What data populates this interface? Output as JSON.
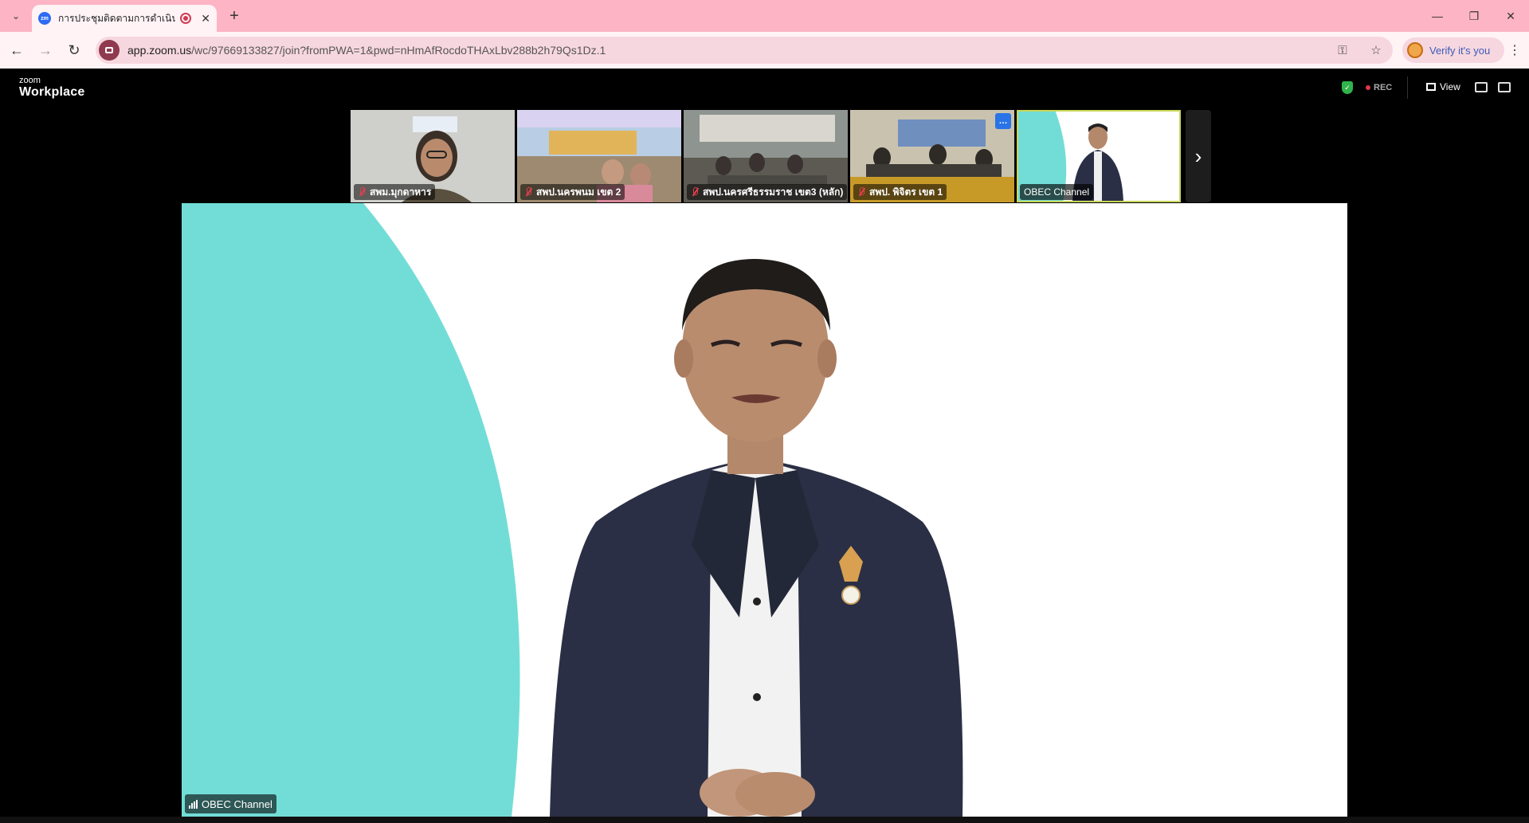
{
  "browser": {
    "tab": {
      "favicon_text": "zm",
      "title": "การประชุมติดตามการดำเนินงาน",
      "close_glyph": "✕"
    },
    "new_tab_glyph": "+",
    "window_controls": {
      "minimize": "—",
      "restore": "❐",
      "close": "✕"
    },
    "nav": {
      "back": "←",
      "forward": "→",
      "reload": "↻"
    },
    "address": {
      "host": "app.zoom.us",
      "path": "/wc/97669133827/join?fromPWA=1&pwd=nHmAfRocdoTHAxLbv288b2h79Qs1Dz.1"
    },
    "omnibox_icons": {
      "password_key": "⚿",
      "bookmark_star": "☆"
    },
    "profile": {
      "label": "Verify it's you"
    },
    "menu_glyph": "⋮"
  },
  "zoom": {
    "logo": {
      "line1": "zoom",
      "line2": "Workplace"
    },
    "header": {
      "rec_label": "REC",
      "view_label": "View",
      "security_glyph": "✓"
    },
    "participants": [
      {
        "name": "สพม.มุกดาหาร",
        "muted": true,
        "colors": [
          "#c8c8c4",
          "#5a5040"
        ]
      },
      {
        "name": "สพป.นครพนม เขต 2",
        "muted": true,
        "colors": [
          "#8ab0d8",
          "#b88a55"
        ]
      },
      {
        "name": "สพป.นครศรีธรรมราช เขต3 (หลัก)",
        "muted": true,
        "colors": [
          "#9a9f9b",
          "#6e6a5e"
        ]
      },
      {
        "name": "สพป. พิจิตร เขต 1",
        "muted": true,
        "colors": [
          "#bfa560",
          "#3e3a36"
        ]
      },
      {
        "name": "OBEC Channel",
        "muted": false,
        "active": true,
        "colors": [
          "#ffffff",
          "#72ddd6"
        ]
      }
    ],
    "thumb_more_glyph": "…",
    "next_page_glyph": "›",
    "active_speaker": {
      "name": "OBEC Channel"
    },
    "colors": {
      "accent_teal": "#72ddd6",
      "rec_red": "#e0384a",
      "active_outline": "#c9d65a"
    }
  }
}
